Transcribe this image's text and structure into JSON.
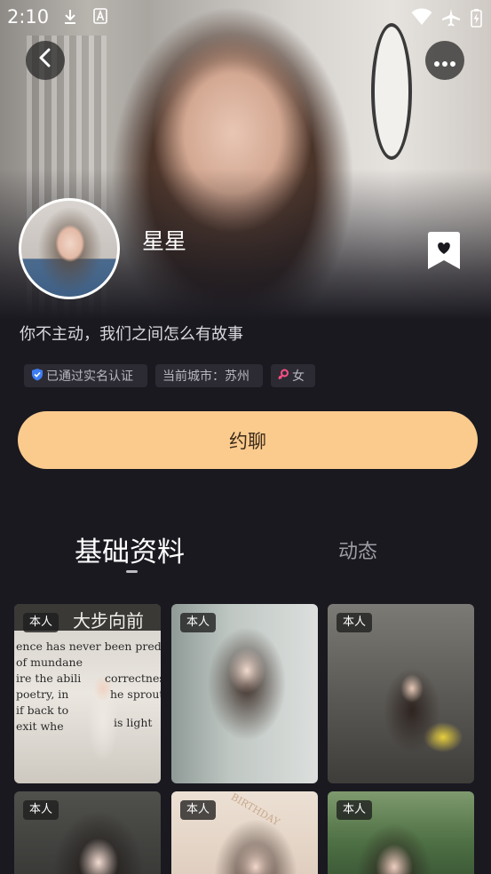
{
  "status_bar": {
    "time": "2:10",
    "icons": [
      "download-icon",
      "a-icon",
      "wifi-icon",
      "airplane-icon",
      "battery-charging-icon"
    ]
  },
  "profile": {
    "nickname": "星星",
    "bio": "你不主动，我们之间怎么有故事",
    "tags": [
      {
        "icon": "verified-shield-icon",
        "label": "已通过实名认证"
      },
      {
        "label": "当前城市：苏州"
      },
      {
        "icon": "female-icon",
        "label": "女"
      }
    ]
  },
  "actions": {
    "chat_label": "约聊"
  },
  "tabs": [
    {
      "label": "基础资料",
      "active": true
    },
    {
      "label": "动态",
      "active": false
    }
  ],
  "photos": [
    {
      "badge": "本人"
    },
    {
      "badge": "本人"
    },
    {
      "badge": "本人"
    },
    {
      "badge": "本人"
    },
    {
      "badge": "本人"
    },
    {
      "badge": "本人"
    }
  ],
  "photo_text": {
    "sign": "大步向前",
    "lines": [
      "ence has never been predet",
      "of mundane",
      "ire the abili",
      "poetry, in",
      "if back to",
      "exit whe"
    ],
    "right_lines": [
      "correctnes",
      "he sprouts",
      "is light"
    ],
    "banner": "BIRTHDAY"
  },
  "colors": {
    "background": "#1a1920",
    "chat_button": "#fbcb8e",
    "tag_background": "#2c2b33",
    "verified_blue": "#3d7df5",
    "female_pink": "#ff4f87"
  }
}
